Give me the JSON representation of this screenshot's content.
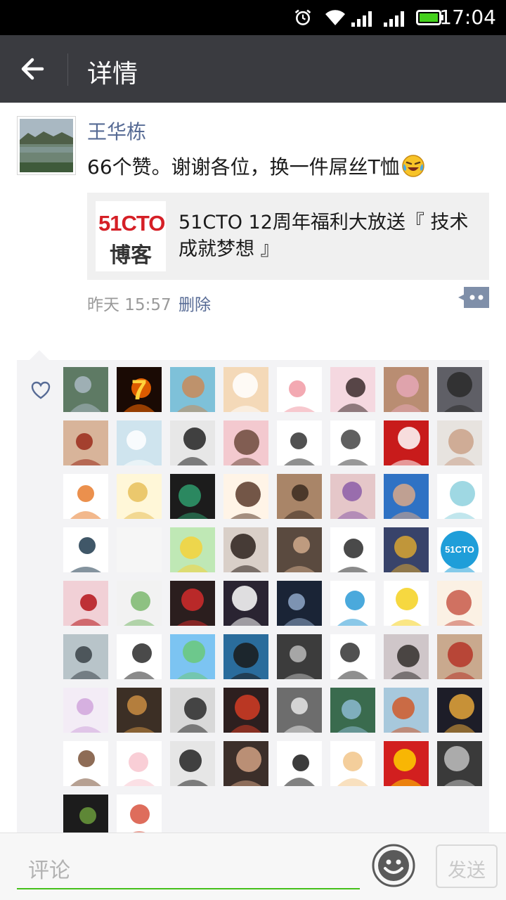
{
  "status_bar": {
    "time": "17:04",
    "icons": [
      "alarm-icon",
      "wifi-icon",
      "signal-icon",
      "signal-icon",
      "battery-icon"
    ],
    "battery_color": "#44d01c"
  },
  "header": {
    "title": "详情",
    "back_icon": "arrow-left-icon",
    "background": "#3a3b40"
  },
  "post": {
    "author": "王华栋",
    "author_color": "#576b95",
    "text": "66个赞。谢谢各位，换一件屌丝T恤",
    "emoji": "laughing-tears-emoji",
    "shared_link": {
      "logo_line1": "51CTO",
      "logo_line2": "博客",
      "title": "51CTO 12周年福利大放送『 技术成就梦想 』"
    },
    "time": "昨天 15:57",
    "delete_label": "删除",
    "more_icon": "comment-more-icon"
  },
  "likes": {
    "icon": "heart-icon",
    "count": 66,
    "avatars": [
      {
        "name": "lake-landscape",
        "bg": "#5e7a64",
        "accent": "#a9b8c2",
        "tag": "lake"
      },
      {
        "name": "fire-seven",
        "bg": "#1a0a04",
        "accent": "#ff6a00",
        "label": "7"
      },
      {
        "name": "boy-photo",
        "bg": "#7ec1d9",
        "accent": "#c98a58"
      },
      {
        "name": "cartoon-cat",
        "bg": "#f4d9b8",
        "accent": "#ffffff"
      },
      {
        "name": "cartoon-bun",
        "bg": "#ffffff",
        "accent": "#f19aa5"
      },
      {
        "name": "girl-sketch",
        "bg": "#f5d8e0",
        "accent": "#3b2c2c"
      },
      {
        "name": "woman-flowers",
        "bg": "#b98d72",
        "accent": "#e5a7b6"
      },
      {
        "name": "man-sunglasses",
        "bg": "#5f5f66",
        "accent": "#2a2a2a"
      },
      {
        "name": "lips-closeup",
        "bg": "#d8b49a",
        "accent": "#9b2b1b"
      },
      {
        "name": "ballerina",
        "bg": "#cfe4ee",
        "accent": "#ffffff"
      },
      {
        "name": "silhouette",
        "bg": "#e7e7e7",
        "accent": "#222222"
      },
      {
        "name": "anime-boy",
        "bg": "#f3c9cf",
        "accent": "#6c4a3c"
      },
      {
        "name": "doodle-hand",
        "bg": "#ffffff",
        "accent": "#333333"
      },
      {
        "name": "text-note",
        "bg": "#ffffff",
        "accent": "#444444"
      },
      {
        "name": "red-seal",
        "bg": "#c81b1b",
        "accent": "#ffffff"
      },
      {
        "name": "baby-photo",
        "bg": "#e7e3df",
        "accent": "#caa28a"
      },
      {
        "name": "fox-cartoon",
        "bg": "#ffffff",
        "accent": "#e87d2e"
      },
      {
        "name": "cool-dog",
        "bg": "#fff7d8",
        "accent": "#e8c05a"
      },
      {
        "name": "tokyo-shirt",
        "bg": "#1c1c1c",
        "accent": "#2e9b6c"
      },
      {
        "name": "girl-scarf",
        "bg": "#fff4e7",
        "accent": "#5a3a2a"
      },
      {
        "name": "girl-laptop",
        "bg": "#a98568",
        "accent": "#3b2a20"
      },
      {
        "name": "purple-girl",
        "bg": "#e5c7c9",
        "accent": "#8c5da8"
      },
      {
        "name": "man-sky",
        "bg": "#2f72c4",
        "accent": "#d8a889"
      },
      {
        "name": "girl-drawing",
        "bg": "#ffffff",
        "accent": "#8ed1de"
      },
      {
        "name": "black-cat-logo",
        "bg": "#ffffff",
        "accent": "#1f3a4e"
      },
      {
        "name": "empty-avatar",
        "bg": "#f6f6f6",
        "accent": "#f6f6f6"
      },
      {
        "name": "plant-pot",
        "bg": "#bfe8b5",
        "accent": "#f5d23a"
      },
      {
        "name": "girl-glasses",
        "bg": "#d9cfc8",
        "accent": "#2b211c"
      },
      {
        "name": "two-men",
        "bg": "#5a4a3f",
        "accent": "#d0a98b"
      },
      {
        "name": "beard-sketch",
        "bg": "#ffffff",
        "accent": "#2a2a2a"
      },
      {
        "name": "transformer",
        "bg": "#38436a",
        "accent": "#d8a431"
      },
      {
        "name": "51cto-helper",
        "bg": "#ffffff",
        "accent": "#1f9ed9",
        "label": "51CTO"
      },
      {
        "name": "anime-warrior",
        "bg": "#f1d0d6",
        "accent": "#b5141a"
      },
      {
        "name": "cactus-pots",
        "bg": "#f2f2f2",
        "accent": "#7cb96e"
      },
      {
        "name": "basketball-dunk",
        "bg": "#2b1e1e",
        "accent": "#d22b2b"
      },
      {
        "name": "chinese-text-card",
        "bg": "#2a2432",
        "accent": "#ffffff"
      },
      {
        "name": "night-portrait",
        "bg": "#1a2436",
        "accent": "#8fa7c8"
      },
      {
        "name": "wave-logo",
        "bg": "#ffffff",
        "accent": "#2a9ad6"
      },
      {
        "name": "minions",
        "bg": "#ffffff",
        "accent": "#f5d11f"
      },
      {
        "name": "eiffel-sketch",
        "bg": "#fbf1e4",
        "accent": "#c85a4a"
      },
      {
        "name": "winter-tree",
        "bg": "#b8c4c9",
        "accent": "#3a4348"
      },
      {
        "name": "young-man",
        "bg": "#ffffff",
        "accent": "#2a2a2a"
      },
      {
        "name": "green-field",
        "bg": "#7cc4f2",
        "accent": "#6bc97a"
      },
      {
        "name": "cats-kissing",
        "bg": "#2a6c9c",
        "accent": "#1a1a1a"
      },
      {
        "name": "believe-yourself",
        "bg": "#3c3c3c",
        "accent": "#b8b8b8"
      },
      {
        "name": "calligraphy-doll",
        "bg": "#ffffff",
        "accent": "#333333"
      },
      {
        "name": "young-man-2",
        "bg": "#cfc6c9",
        "accent": "#322e2c"
      },
      {
        "name": "vintage-can",
        "bg": "#c9a98e",
        "accent": "#b53528"
      },
      {
        "name": "white-hair-anime",
        "bg": "#f3ecf6",
        "accent": "#d0a6dc"
      },
      {
        "name": "orange-cat",
        "bg": "#3c2f25",
        "accent": "#c98c42"
      },
      {
        "name": "leader-photo",
        "bg": "#d8d8d8",
        "accent": "#2a2a2a"
      },
      {
        "name": "ninja-art",
        "bg": "#2d1f1f",
        "accent": "#d43c24"
      },
      {
        "name": "two-dogs",
        "bg": "#6d6d6d",
        "accent": "#e6e6e6"
      },
      {
        "name": "waterfall",
        "bg": "#3a6b4e",
        "accent": "#8cbad1"
      },
      {
        "name": "balloon-canyon",
        "bg": "#a7c8dc",
        "accent": "#d05a2a"
      },
      {
        "name": "city-night",
        "bg": "#1d1d28",
        "accent": "#e5a63a"
      },
      {
        "name": "rabbit-cartoon",
        "bg": "#ffffff",
        "accent": "#7a5238"
      },
      {
        "name": "pink-pig",
        "bg": "#ffffff",
        "accent": "#f8c6cf"
      },
      {
        "name": "lamp",
        "bg": "#e6e6e6",
        "accent": "#222222"
      },
      {
        "name": "man-dark",
        "bg": "#3c2f2a",
        "accent": "#d0a082"
      },
      {
        "name": "w-logo",
        "bg": "#ffffff",
        "accent": "#1a1a1a"
      },
      {
        "name": "cartoon-boy",
        "bg": "#ffffff",
        "accent": "#f2c68a"
      },
      {
        "name": "china-flag-boy",
        "bg": "#d21f1f",
        "accent": "#ffd100"
      },
      {
        "name": "wolf",
        "bg": "#3a3a3a",
        "accent": "#bfbfbf"
      },
      {
        "name": "soldier-sketch",
        "bg": "#1c1c1c",
        "accent": "#6a9a3b"
      },
      {
        "name": "cute-cat",
        "bg": "#ffffff",
        "accent": "#d8543f"
      }
    ]
  },
  "comment_bar": {
    "placeholder": "评论",
    "emoji_icon": "smiley-icon",
    "send_label": "发送",
    "accent": "#45c01a"
  }
}
